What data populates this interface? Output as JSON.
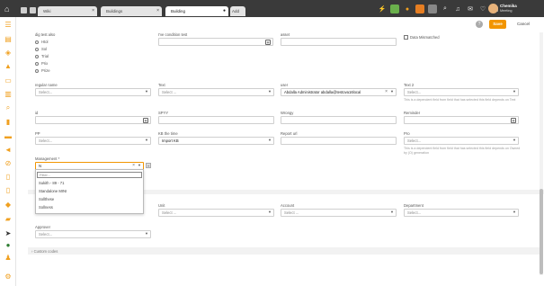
{
  "tabs": [
    {
      "label": "Wiki"
    },
    {
      "label": "Buildings"
    },
    {
      "label": "Building"
    },
    {
      "label": "Add"
    }
  ],
  "user": {
    "name": "Chemika",
    "sub": "Meeting"
  },
  "toolbar": {
    "save_label": "Save",
    "cancel_label": "Cancel",
    "help_label": "?"
  },
  "form": {
    "dig_test_label": "dig test also",
    "radio_options": [
      "Htol",
      "Sol",
      "Trial",
      "Prix",
      "Prize"
    ],
    "condition_test_label": "I've condition test",
    "asset_label": "asset",
    "data_mismatch_label": "Data Mismatched",
    "regular_name_label": "regular name",
    "regular_name_placeholder": "Select...",
    "text_label": "Text",
    "text_placeholder": "Select ...",
    "user_label": "user",
    "user_value": "Abdalla Administrator abdalla@testova16local",
    "text2_label": "Text 2",
    "text2_placeholder": "Select...",
    "text2_help": "This is a dependent field from field that has selected this field depends on Text",
    "id_label": "id",
    "spyy_label": "SPYY",
    "wrongy_label": "Wrongy",
    "reminder_label": "Reminder",
    "pp_label": "PP",
    "pp_placeholder": "Select...",
    "kb_label": "KB the time",
    "kb_value": "Import KB",
    "report_label": "Report url",
    "pro_label": "Pro",
    "pro_placeholder": "Select...",
    "pro_help": "This is a dependent field from field that has selected this field depends on Owned by (O) generation",
    "management_label": "Management *",
    "management_value": "N",
    "dropdown_filter_placeholder": "Filter...",
    "dropdown_items": [
      "Sukith - 89 - 71",
      "Standalone MINI",
      "Sollthese",
      "Sollness"
    ],
    "unit_label": "Unit",
    "unit_placeholder": "Select ...",
    "account_label": "Account",
    "account_placeholder": "Select ...",
    "department_label": "Department",
    "department_placeholder": "Select...",
    "approver_label": "Approver",
    "approver_placeholder": "Select...",
    "custom_codes_label": "Custom codes"
  },
  "colors": {
    "accent": "#f29500",
    "topbar": "#3a3a3a",
    "sidebar_icon": "#f0a020"
  }
}
